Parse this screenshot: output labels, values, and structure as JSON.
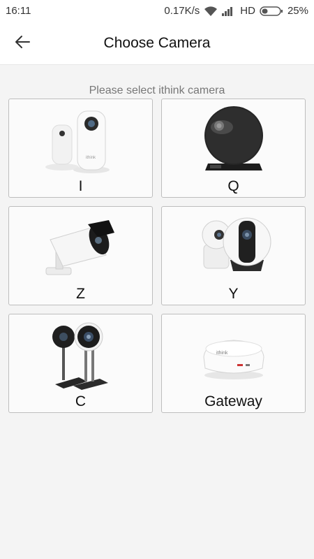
{
  "status_bar": {
    "time": "16:11",
    "speed": "0.17K/s",
    "network": "HD",
    "battery": "25%"
  },
  "header": {
    "title": "Choose Camera"
  },
  "prompt": "Please select ithink camera",
  "cameras": [
    {
      "label": "I",
      "icon": "camera-i-image"
    },
    {
      "label": "Q",
      "icon": "camera-q-image"
    },
    {
      "label": "Z",
      "icon": "camera-z-image"
    },
    {
      "label": "Y",
      "icon": "camera-y-image"
    },
    {
      "label": "C",
      "icon": "camera-c-image"
    },
    {
      "label": "Gateway",
      "icon": "gateway-image"
    }
  ],
  "brand_text": "ithink"
}
